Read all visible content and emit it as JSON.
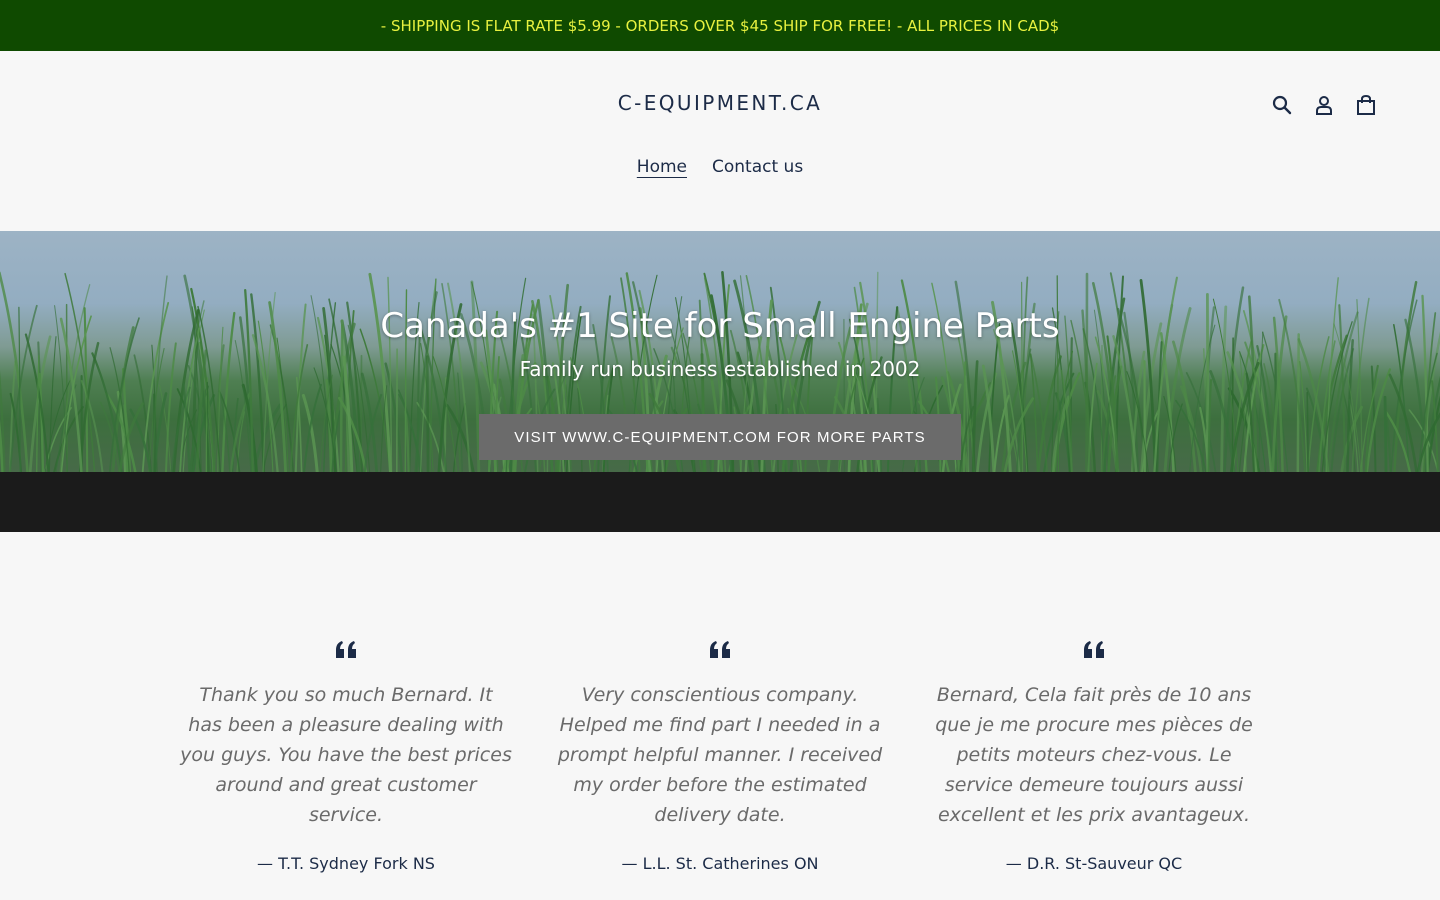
{
  "announcement": {
    "text": "- SHIPPING IS FLAT RATE $5.99 - ORDERS OVER $45 SHIP FOR FREE! - ALL PRICES IN CAD$"
  },
  "header": {
    "logo": "C-EQUIPMENT.CA",
    "icons": [
      "search-icon",
      "account-icon",
      "cart-icon"
    ]
  },
  "nav": {
    "items": [
      {
        "label": "Home",
        "active": true
      },
      {
        "label": "Contact us",
        "active": false
      }
    ]
  },
  "hero": {
    "title": "Canada's #1 Site for Small Engine Parts",
    "subtitle": "Family run business established in 2002",
    "button_label": "VISIT WWW.C-EQUIPMENT.COM FOR MORE PARTS"
  },
  "testimonials": [
    {
      "text": "Thank you so much Bernard.  It has been a pleasure dealing with you guys. You have the best prices around and great customer service.",
      "author": "— T.T. Sydney Fork NS"
    },
    {
      "text": "Very conscientious company. Helped me find part I needed in a prompt helpful manner. I received my order before the estimated delivery date.",
      "author": "— L.L. St. Catherines ON"
    },
    {
      "text": "Bernard, Cela fait près de 10 ans que je me procure mes pièces de petits moteurs chez-vous. Le service demeure toujours aussi excellent et les prix avantageux.",
      "author": "— D.R. St-Sauveur QC"
    }
  ],
  "colors": {
    "announcement_bg": "#0f4a00",
    "announcement_text": "#e7f13f",
    "text_dark": "#1c2b47",
    "button_bg": "#6b6b6b"
  }
}
